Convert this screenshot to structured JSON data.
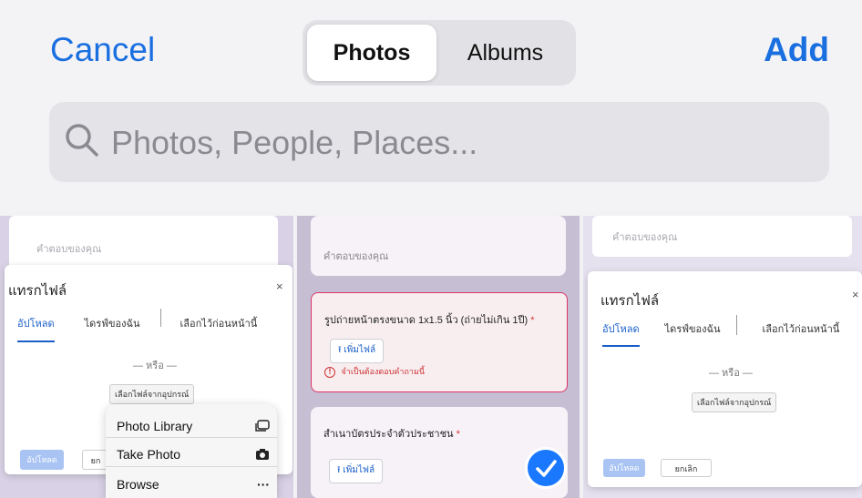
{
  "header": {
    "cancel_label": "Cancel",
    "add_label": "Add",
    "segments": [
      "Photos",
      "Albums"
    ],
    "selected_segment": "Photos"
  },
  "search": {
    "placeholder": "Photos, People, Places..."
  },
  "thumb1": {
    "answer_hint": "คำตอบของคุณ",
    "dialog_title": "แทรกไฟล์",
    "close": "×",
    "tabs": [
      "อัปโหลด",
      "ไดรฟ์ของฉัน",
      "เลือกไว้ก่อนหน้านี้"
    ],
    "or_text": "— หรือ —",
    "choose_button": "เลือกไฟล์จากอุปกรณ์",
    "upload_button": "อัปโหลด",
    "cancel_button_partial": "ยก",
    "menu": [
      {
        "label": "Photo Library",
        "icon": "photo-library-icon"
      },
      {
        "label": "Take Photo",
        "icon": "camera-icon"
      },
      {
        "label": "Browse",
        "icon": "ellipsis-icon"
      }
    ]
  },
  "thumb2": {
    "answer_hint": "คำตอบของคุณ",
    "q1_title": "รูปถ่ายหน้าตรงขนาด 1x1.5 นิ้ว (ถ่ายไม่เกิน 1ปี)",
    "required_mark": "*",
    "add_file": "เพิ่มไฟล์",
    "error_text": "จำเป็นต้องตอบคำถามนี้",
    "q2_title": "สำเนาบัตรประจำตัวประชาชน"
  },
  "thumb3": {
    "answer_hint": "คำตอบของคุณ",
    "dialog_title": "แทรกไฟล์",
    "close": "×",
    "tabs": [
      "อัปโหลด",
      "ไดรฟ์ของฉัน",
      "เลือกไว้ก่อนหน้านี้"
    ],
    "or_text": "— หรือ —",
    "choose_button": "เลือกไฟล์จากอุปกรณ์",
    "upload_button": "อัปโหลด",
    "cancel_button": "ยกเลิก"
  },
  "colors": {
    "accent": "#1a6fe0",
    "selection": "#1a78ff",
    "error": "#cc3333"
  }
}
